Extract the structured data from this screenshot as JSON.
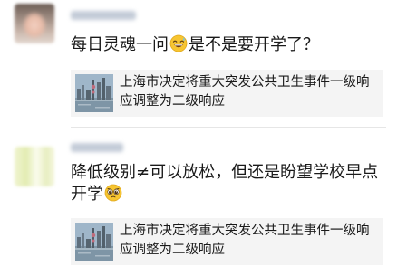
{
  "comments": [
    {
      "text_before_emoji": "每日灵魂一问",
      "emoji_icon": "grinning-sweat-emoji",
      "text_after_emoji": "是不是要开学了？",
      "link_card": {
        "title": "上海市决定将重大突发公共卫生事件一级响应调整为二级响应",
        "thumbnail_icon": "shanghai-skyline-thumbnail"
      }
    },
    {
      "text_before_emoji": "降低级别≠可以放松，但还是盼望学校早点开学",
      "emoji_icon": "pleading-face-emoji",
      "text_after_emoji": "",
      "link_card": {
        "title": "上海市决定将重大突发公共卫生事件一级响应调整为二级响应",
        "thumbnail_icon": "shanghai-skyline-thumbnail"
      }
    }
  ],
  "colors": {
    "background": "#ffffff",
    "card_background": "#f4f4f4",
    "text": "#1a1a1a"
  }
}
